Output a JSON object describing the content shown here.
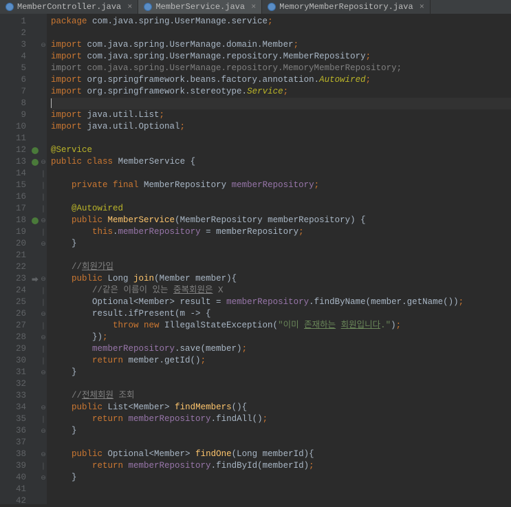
{
  "tabs": [
    {
      "name": "MemberController.java",
      "active": false
    },
    {
      "name": "MemberService.java",
      "active": true
    },
    {
      "name": "MemoryMemberRepository.java",
      "active": false
    }
  ],
  "lines": {
    "count": 42,
    "marks": {
      "12": "leaf",
      "13": "leaf",
      "18": "leaf",
      "23": "arr"
    }
  },
  "code": {
    "l1": {
      "kw": "package",
      "pkg": " com.java.spring.UserManage.service",
      "end": ";"
    },
    "l3": {
      "kw": "import",
      "pkg": " com.java.spring.UserManage.domain.Member",
      "end": ";"
    },
    "l4": {
      "kw": "import",
      "pkg": " com.java.spring.UserManage.repository.MemberRepository",
      "end": ";"
    },
    "l5": "import com.java.spring.UserManage.repository.MemoryMemberRepository;",
    "l6": {
      "kw": "import",
      "pkg": " org.springframework.beans.factory.annotation.",
      "ann": "Autowired",
      "end": ";"
    },
    "l7": {
      "kw": "import",
      "pkg": " org.springframework.stereotype.",
      "ann": "Service",
      "end": ";"
    },
    "l9": {
      "kw": "import",
      "pkg": " java.util.List",
      "end": ";"
    },
    "l10": {
      "kw": "import",
      "pkg": " java.util.Optional",
      "end": ";"
    },
    "l12": "@Service",
    "l13a": "public",
    "l13b": "class",
    "l13c": "MemberService",
    "l13d": "{",
    "l15a": "private final ",
    "l15b": "MemberRepository ",
    "l15c": "memberRepository",
    "l15d": ";",
    "l17": "@Autowired",
    "l18a": "public ",
    "l18b": "MemberService",
    "l18c": "(MemberRepository memberRepository) {",
    "l19a": "this",
    "l19b": ".",
    "l19c": "memberRepository",
    "l19d": " = memberRepository",
    "l19e": ";",
    "l20": "}",
    "l22a": "//",
    "l22b": "회원가입",
    "l23a": "public ",
    "l23b": "Long ",
    "l23c": "join",
    "l23d": "(Member member){",
    "l24a": "//같은 이름이 있는 ",
    "l24b": "중복회원은",
    "l24c": " X",
    "l25a": "Optional<Member> result = ",
    "l25b": "memberRepository",
    "l25c": ".findByName(member.getName())",
    "l25d": ";",
    "l26a": "result.ifPresent(m -> {",
    "l27a": "throw new ",
    "l27b": "IllegalStateException(",
    "l27c": "\"이미 ",
    "l27d": "존재하는",
    "l27e": " ",
    "l27f": "회원입니다",
    "l27g": ".\"",
    "l27h": ")",
    "l27i": ";",
    "l28a": "})",
    "l28b": ";",
    "l29a": "memberRepository",
    "l29b": ".save(member)",
    "l29c": ";",
    "l30a": "return ",
    "l30b": "member.getId()",
    "l30c": ";",
    "l31": "}",
    "l33a": "//",
    "l33b": "전체회원",
    "l33c": " 조회",
    "l34a": "public ",
    "l34b": "List<Member> ",
    "l34c": "findMembers",
    "l34d": "(){",
    "l35a": "return ",
    "l35b": "memberRepository",
    "l35c": ".findAll()",
    "l35d": ";",
    "l36": "}",
    "l38a": "public ",
    "l38b": "Optional<Member> ",
    "l38c": "findOne",
    "l38d": "(Long memberId){",
    "l39a": "return ",
    "l39b": "memberRepository",
    "l39c": ".findById(memberId)",
    "l39d": ";",
    "l40": "}"
  }
}
